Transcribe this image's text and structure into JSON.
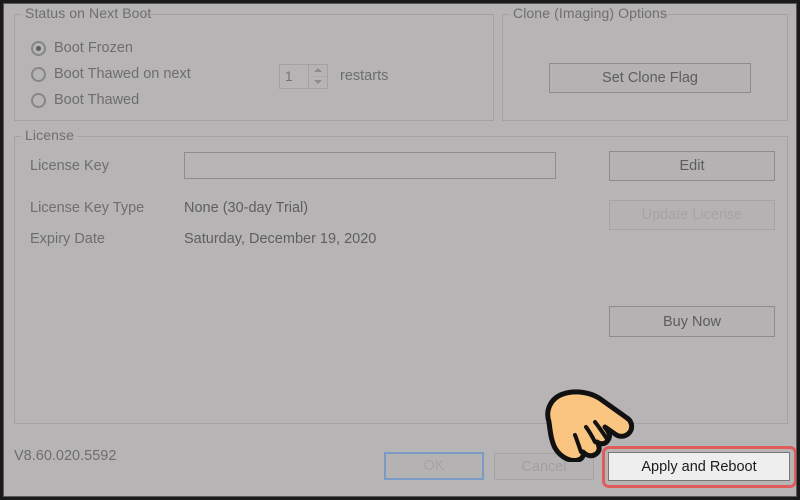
{
  "dialog": {
    "version": "V8.60.020.5592"
  },
  "status_group": {
    "title": "Status on Next Boot",
    "options": [
      {
        "label": "Boot Frozen",
        "checked": true
      },
      {
        "label": "Boot Thawed on next",
        "checked": false
      },
      {
        "label": "Boot Thawed",
        "checked": false
      }
    ],
    "restarts": {
      "value": "1",
      "unit_label": "restarts"
    }
  },
  "clone_group": {
    "title": "Clone (Imaging) Options",
    "set_clone_flag_label": "Set Clone Flag"
  },
  "license_group": {
    "title": "License",
    "key_label": "License Key",
    "key_value": "",
    "key_placeholder": "",
    "type_label": "License Key Type",
    "type_value": "None (30-day Trial)",
    "expiry_label": "Expiry Date",
    "expiry_value": "Saturday, December 19, 2020",
    "edit_label": "Edit",
    "update_label": "Update License",
    "buy_label": "Buy Now"
  },
  "footer": {
    "ok_label": "OK",
    "cancel_label": "Cancel",
    "apply_label": "Apply and Reboot"
  },
  "annotation": {
    "cursor": "pointing-hand-cursor",
    "highlight_color": "#e05c5c",
    "focus_color": "#7a9cc4"
  }
}
